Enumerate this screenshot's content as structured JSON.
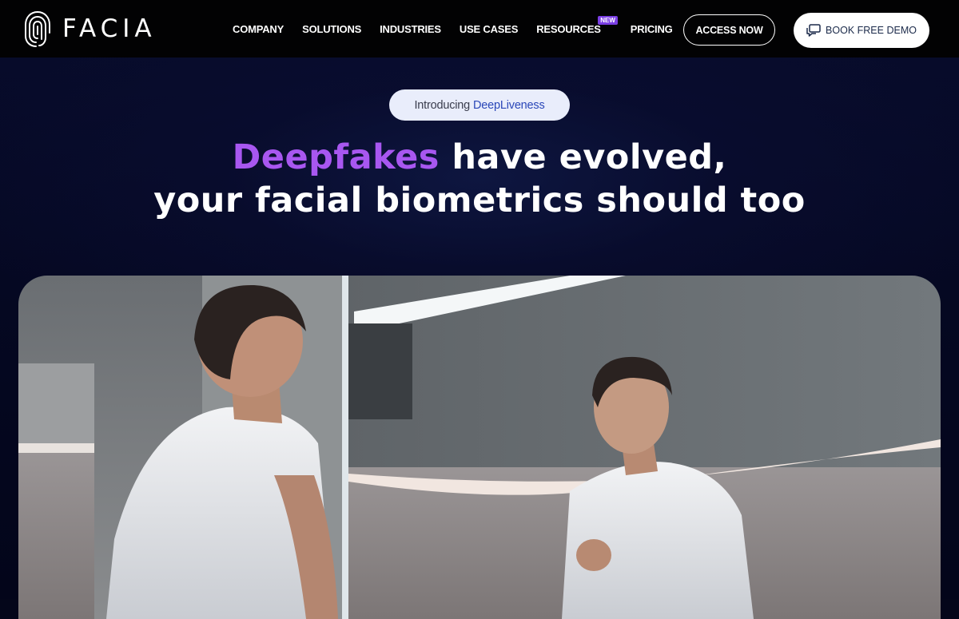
{
  "brand": {
    "name": "FACIA"
  },
  "nav": {
    "items": [
      {
        "label": "COMPANY"
      },
      {
        "label": "SOLUTIONS"
      },
      {
        "label": "INDUSTRIES"
      },
      {
        "label": "USE CASES"
      },
      {
        "label": "RESOURCES",
        "badge": "NEW"
      },
      {
        "label": "PRICING"
      }
    ],
    "access_button": "ACCESS NOW",
    "demo_button": "BOOK FREE DEMO",
    "demo_icon": "chat-bubble-icon"
  },
  "hero": {
    "pill_prefix": "Introducing",
    "pill_accent": "DeepLiveness",
    "headline_highlight": "Deepfakes",
    "headline_rest_line1": " have evolved,",
    "headline_line2": "your facial biometrics should too"
  },
  "colors": {
    "highlight": "#a857f0",
    "badge": "#7b3fe4",
    "pill_accent": "#2a47b8"
  }
}
